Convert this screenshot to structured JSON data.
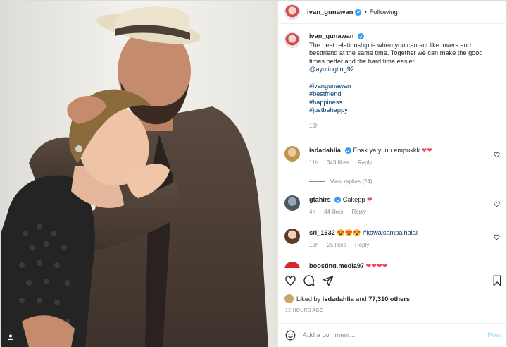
{
  "header": {
    "username": "ivan_gunawan",
    "separator": "•",
    "follow_status": "Following"
  },
  "caption": {
    "username": "ivan_gunawan",
    "text": "The best relationship is when you can act like lovers and bestfriend at the same time. Together we can make the good times better and the hard time easier.",
    "mention": "@ayutingting92",
    "hashtags": [
      "#ivangunawan",
      "#bestfriend",
      "#happiness",
      "#justbehappy"
    ],
    "time": "12h"
  },
  "comments": [
    {
      "username": "isdadahlia",
      "verified": true,
      "text": "Enak ya yuuu empukkk",
      "emoji": "❤❤",
      "time": "11h",
      "likes": "343 likes",
      "reply": "Reply",
      "view_replies": "View replies (24)"
    },
    {
      "username": "gtahirs",
      "verified": true,
      "text": "Cakepp",
      "emoji": "❤",
      "time": "4h",
      "likes": "84 likes",
      "reply": "Reply"
    },
    {
      "username": "sri_1632",
      "verified": false,
      "text": "😍😍😍",
      "mention": "#kawalsampaihalal",
      "time": "12h",
      "likes": "25 likes",
      "reply": "Reply"
    },
    {
      "username": "boosting.media97",
      "text": "❤❤❤❤"
    }
  ],
  "actions": {
    "icons": [
      "heart-icon",
      "comment-icon",
      "share-icon",
      "bookmark-icon"
    ]
  },
  "likes": {
    "prefix": "Liked by",
    "user": "isdadahlia",
    "mid": "and",
    "count": "77,310 others"
  },
  "time_ago": "12 HOURS AGO",
  "add_comment": {
    "placeholder": "Add a comment...",
    "post_label": "Post"
  },
  "colors": {
    "link": "#00376b",
    "verified": "#3897f0",
    "heart": "#ed4956",
    "muted": "#8e8e8e"
  }
}
